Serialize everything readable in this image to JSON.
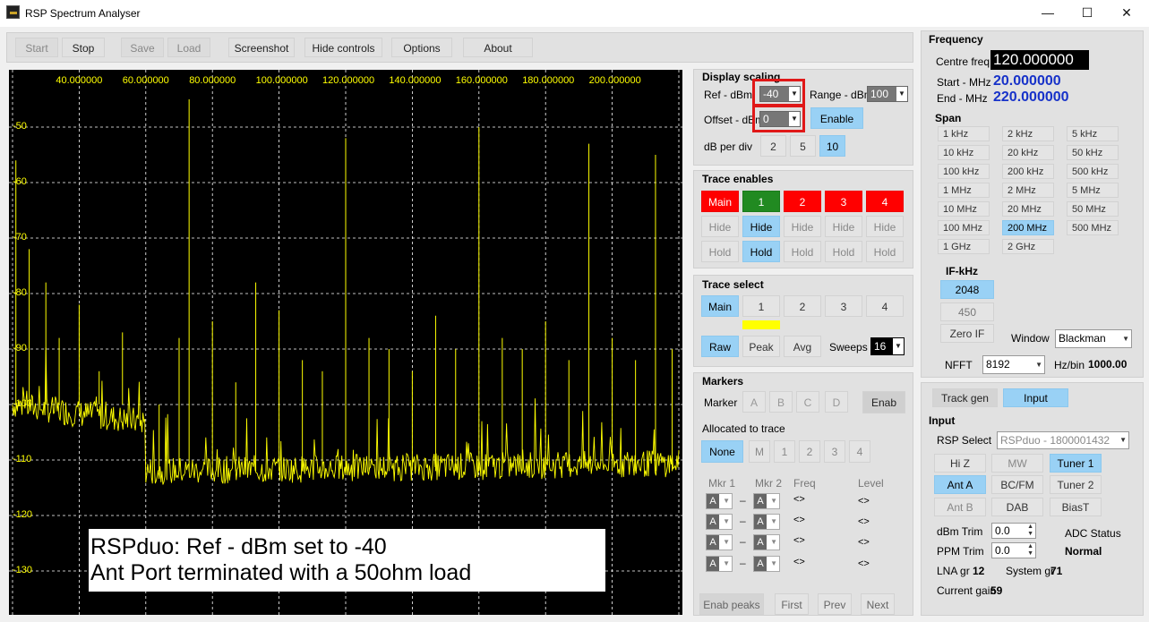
{
  "window": {
    "title": "RSP Spectrum Analyser",
    "min": "—",
    "max": "☐",
    "close": "✕"
  },
  "toolbar": {
    "start": "Start",
    "stop": "Stop",
    "save": "Save",
    "load": "Load",
    "screenshot": "Screenshot",
    "hide_controls": "Hide controls",
    "options": "Options",
    "about": "About"
  },
  "spectrum": {
    "x_ticks": [
      "40.000000",
      "60.000000",
      "80.000000",
      "100.000000",
      "120.000000",
      "140.000000",
      "160.000000",
      "180.000000",
      "200.000000"
    ],
    "y_ticks": [
      "-50",
      "-60",
      "-70",
      "-80",
      "-90",
      "-100",
      "-110",
      "-120",
      "-130"
    ],
    "overlay_line1": "RSPduo: Ref - dBm set to -40",
    "overlay_line2": "Ant Port terminated with a 50ohm load",
    "trace_color": "#ffff00",
    "grid_color": "#ffffff"
  },
  "chart_data": {
    "type": "line",
    "xlim": [
      20,
      220
    ],
    "ylim": [
      -140,
      -40
    ],
    "x_ticks": [
      40,
      60,
      80,
      100,
      120,
      140,
      160,
      180,
      200
    ],
    "y_ticks": [
      -50,
      -60,
      -70,
      -80,
      -90,
      -100,
      -110,
      -120,
      -130
    ],
    "noise_floor_low": -100,
    "noise_floor_high": -112,
    "floor_step_at": 60,
    "spurs": [
      {
        "x": 21,
        "y": -56
      },
      {
        "x": 25,
        "y": -72
      },
      {
        "x": 30,
        "y": -78
      },
      {
        "x": 34,
        "y": -88
      },
      {
        "x": 40,
        "y": -82
      },
      {
        "x": 46,
        "y": -94
      },
      {
        "x": 53,
        "y": -87
      },
      {
        "x": 64,
        "y": -100
      },
      {
        "x": 70,
        "y": -88
      },
      {
        "x": 73,
        "y": -45
      },
      {
        "x": 80,
        "y": -85
      },
      {
        "x": 87,
        "y": -96
      },
      {
        "x": 93,
        "y": -78
      },
      {
        "x": 100,
        "y": -83
      },
      {
        "x": 107,
        "y": -92
      },
      {
        "x": 113,
        "y": -94
      },
      {
        "x": 120,
        "y": -52
      },
      {
        "x": 127,
        "y": -88
      },
      {
        "x": 133,
        "y": -90
      },
      {
        "x": 140,
        "y": -94
      },
      {
        "x": 147,
        "y": -84
      },
      {
        "x": 153,
        "y": -90
      },
      {
        "x": 160,
        "y": -50
      },
      {
        "x": 167,
        "y": -88
      },
      {
        "x": 173,
        "y": -90
      },
      {
        "x": 180,
        "y": -85
      },
      {
        "x": 187,
        "y": -92
      },
      {
        "x": 193,
        "y": -53
      },
      {
        "x": 200,
        "y": -88
      },
      {
        "x": 207,
        "y": -92
      },
      {
        "x": 213,
        "y": -55
      },
      {
        "x": 218,
        "y": -90
      }
    ]
  },
  "display_scaling": {
    "title": "Display scaling",
    "ref_label": "Ref - dBm",
    "ref_value": "-40",
    "range_label": "Range - dBm",
    "range_value": "100",
    "offset_label": "Offset - dBm",
    "offset_value": "0",
    "enable": "Enable",
    "dbdiv_label": "dB per div",
    "dbdiv": [
      "2",
      "5",
      "10"
    ]
  },
  "trace_enables": {
    "title": "Trace enables",
    "traces": [
      "Main",
      "1",
      "2",
      "3",
      "4"
    ],
    "hide": "Hide",
    "hold": "Hold"
  },
  "trace_select": {
    "title": "Trace select",
    "traces": [
      "Main",
      "1",
      "2",
      "3",
      "4"
    ],
    "raw": "Raw",
    "peak": "Peak",
    "avg": "Avg",
    "sweeps_label": "Sweeps",
    "sweeps_value": "16"
  },
  "markers": {
    "title": "Markers",
    "marker_label": "Marker",
    "letters": [
      "A",
      "B",
      "C",
      "D"
    ],
    "enab": "Enab",
    "allocated_label": "Allocated to trace",
    "alloc": [
      "None",
      "M",
      "1",
      "2",
      "3",
      "4"
    ],
    "col_mkr1": "Mkr 1",
    "col_mkr2": "Mkr 2",
    "col_freq": "Freq",
    "col_level": "Level",
    "row_value": "A",
    "dash": "–",
    "arrows": "<>",
    "enab_peaks": "Enab peaks",
    "first": "First",
    "prev": "Prev",
    "next": "Next"
  },
  "frequency": {
    "title": "Frequency",
    "centre_label": "Centre freq",
    "centre_value": "120.000000",
    "start_label": "Start - MHz",
    "start_value": "20.000000",
    "end_label": "End - MHz",
    "end_value": "220.000000",
    "span_title": "Span",
    "span": [
      "1 kHz",
      "2 kHz",
      "5 kHz",
      "10 kHz",
      "20 kHz",
      "50 kHz",
      "100 kHz",
      "200 kHz",
      "500 kHz",
      "1 MHz",
      "2 MHz",
      "5 MHz",
      "10 MHz",
      "20 MHz",
      "50 MHz",
      "100 MHz",
      "200 MHz",
      "500 MHz",
      "1 GHz",
      "2 GHz"
    ],
    "if_title": "IF-kHz",
    "if": [
      "2048",
      "450",
      "Zero IF"
    ],
    "window_label": "Window",
    "window_value": "Blackman",
    "nfft_label": "NFFT",
    "nfft_value": "8192",
    "hzbin_label": "Hz/bin",
    "hzbin_value": "1000.00"
  },
  "input": {
    "track_gen": "Track gen",
    "input_tab": "Input",
    "title": "Input",
    "rsp_select_label": "RSP Select",
    "rsp_select_value": "RSPduo - 1800001432",
    "buttons": [
      "Hi Z",
      "MW",
      "Tuner 1",
      "Ant A",
      "BC/FM",
      "Tuner 2",
      "Ant B",
      "DAB",
      "BiasT"
    ],
    "dbm_trim_label": "dBm Trim",
    "dbm_trim_value": "0.0",
    "ppm_trim_label": "PPM Trim",
    "ppm_trim_value": "0.0",
    "adc_status_label": "ADC Status",
    "adc_status_value": "Normal",
    "lna_label": "LNA gr",
    "lna_value": "12",
    "system_label": "System gr",
    "system_value": "71",
    "current_label": "Current gain",
    "current_value": "59"
  }
}
